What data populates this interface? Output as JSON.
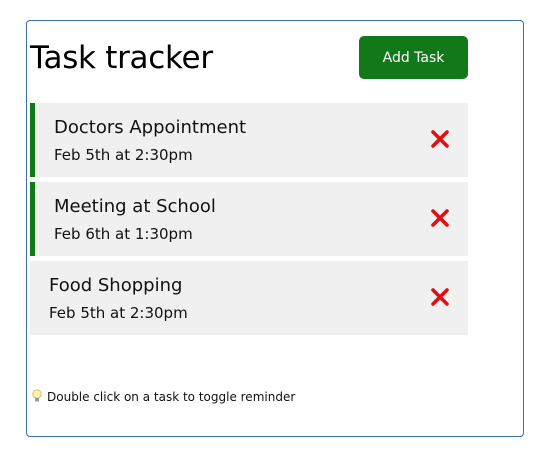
{
  "header": {
    "title": "Task tracker",
    "add_button_label": "Add Task"
  },
  "tasks": [
    {
      "text": "Doctors Appointment",
      "day": "Feb 5th at 2:30pm",
      "reminder": true
    },
    {
      "text": "Meeting at School",
      "day": "Feb 6th at 1:30pm",
      "reminder": true
    },
    {
      "text": "Food Shopping",
      "day": "Feb 5th at 2:30pm",
      "reminder": false
    }
  ],
  "footer": {
    "hint": "Double click on a task to toggle reminder",
    "hint_icon": "lightbulb-icon"
  },
  "colors": {
    "accent": "#12791a",
    "delete": "#e01010",
    "card_border": "#3a6ea5",
    "task_bg": "#f0f0f0"
  }
}
